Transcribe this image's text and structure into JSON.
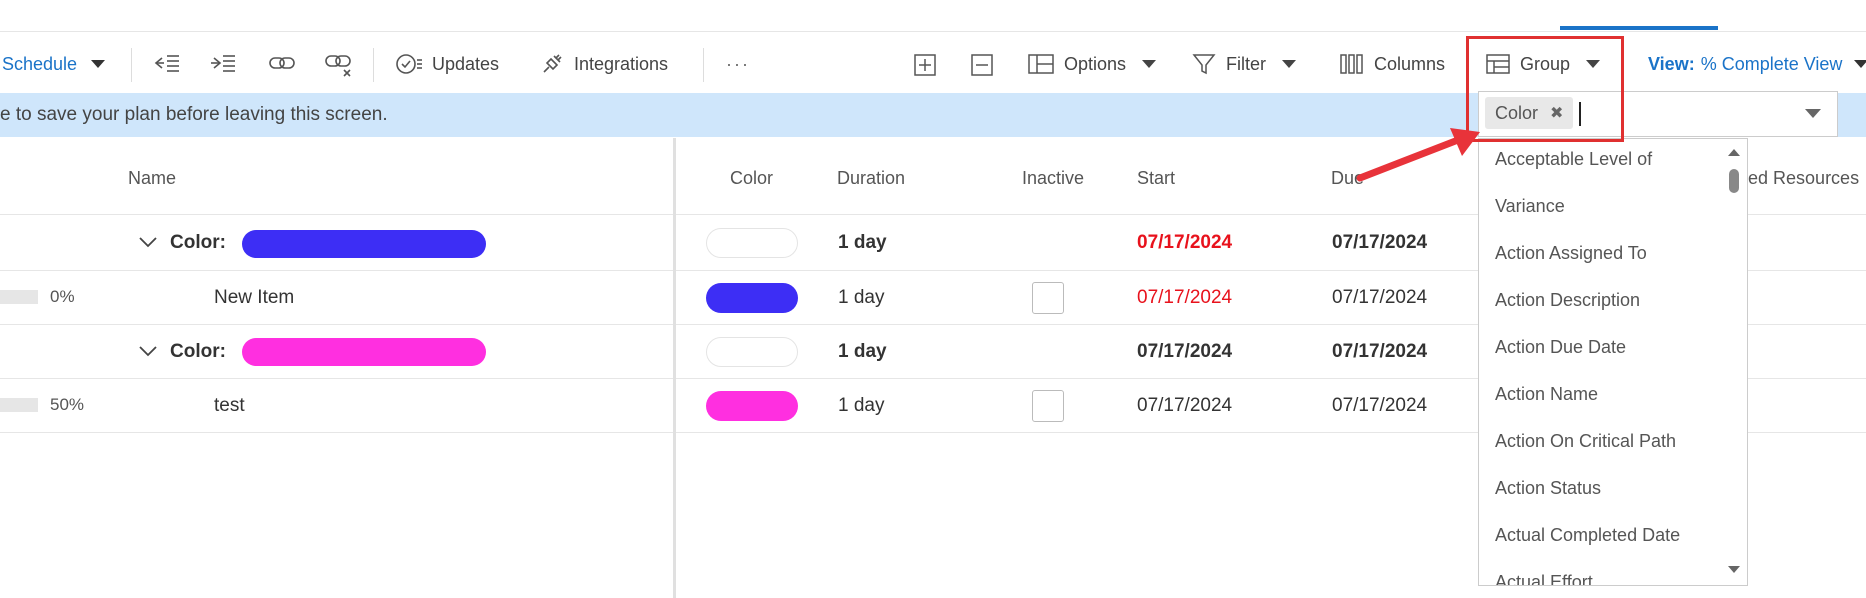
{
  "toolbar": {
    "schedule_label": "Schedule",
    "updates_label": "Updates",
    "integrations_label": "Integrations",
    "more_label": "···",
    "options_label": "Options",
    "filter_label": "Filter",
    "columns_label": "Columns",
    "group_label": "Group",
    "view_prefix": "View:",
    "view_value": "% Complete View"
  },
  "banner": {
    "text": "e to save your plan before leaving this screen."
  },
  "left_headers": {
    "name": "Name"
  },
  "right_headers": {
    "color": "Color",
    "duration": "Duration",
    "inactive": "Inactive",
    "start": "Start",
    "due": "Due",
    "assigned_resources": "ned Resources"
  },
  "rows": [
    {
      "type": "group",
      "label": "Color:",
      "color": "#3d2ef5",
      "duration": "1 day",
      "start": "07/17/2024",
      "due": "07/17/2024",
      "start_red": true
    },
    {
      "type": "item",
      "progress": "0%",
      "name": "New Item",
      "color": "#3d2ef5",
      "duration": "1 day",
      "start": "07/17/2024",
      "due": "07/17/2024",
      "start_red": true
    },
    {
      "type": "group",
      "label": "Color:",
      "color": "#ff2fe0",
      "duration": "1 day",
      "start": "07/17/2024",
      "due": "07/17/2024",
      "start_red": false
    },
    {
      "type": "item",
      "progress": "50%",
      "name": "test",
      "color": "#ff2fe0",
      "duration": "1 day",
      "start": "07/17/2024",
      "due": "07/17/2024",
      "start_red": false
    }
  ],
  "group_select": {
    "selected_tag": "Color",
    "options": [
      "Acceptable Level of",
      "Variance",
      "Action Assigned To",
      "Action Description",
      "Action Due Date",
      "Action Name",
      "Action On Critical Path",
      "Action Status",
      "Actual Completed Date",
      "Actual Effort"
    ]
  },
  "colors": {
    "accent": "#1a73c8",
    "banner": "#cfe6fb",
    "highlight_box": "#e03030",
    "arrow": "#e8333a",
    "late_date": "#e8121c"
  }
}
